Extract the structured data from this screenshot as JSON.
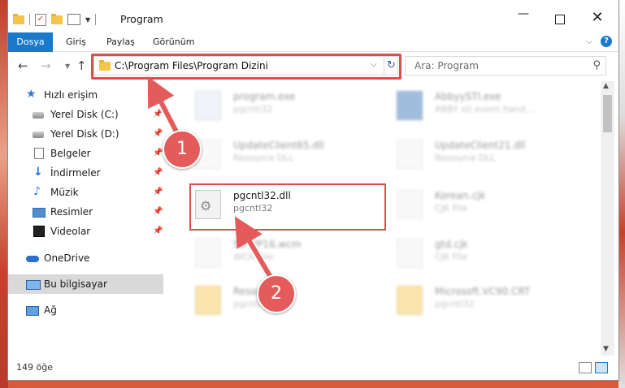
{
  "window": {
    "title": "Program"
  },
  "ribbon": {
    "tabs": [
      "Dosya",
      "Giriş",
      "Paylaş",
      "Görünüm"
    ],
    "help_label": "?"
  },
  "nav": {
    "address": "C:\\Program Files\\Program Dizini",
    "search_placeholder": "Ara: Program"
  },
  "sidebar": {
    "items": [
      {
        "label": "Hızlı erişim",
        "icon": "star-icon"
      },
      {
        "label": "Yerel Disk (C:)",
        "icon": "drive-icon"
      },
      {
        "label": "Yerel Disk (D:)",
        "icon": "drive-icon"
      },
      {
        "label": "Belgeler",
        "icon": "document-icon"
      },
      {
        "label": "İndirmeler",
        "icon": "download-icon"
      },
      {
        "label": "Müzik",
        "icon": "music-icon"
      },
      {
        "label": "Resimler",
        "icon": "pictures-icon"
      },
      {
        "label": "Videolar",
        "icon": "video-icon"
      },
      {
        "label": "OneDrive",
        "icon": "cloud-icon"
      },
      {
        "label": "Bu bilgisayar",
        "icon": "computer-icon"
      },
      {
        "label": "Ağ",
        "icon": "network-icon"
      }
    ]
  },
  "files": [
    {
      "name": "program.exe",
      "sub": "pgcntl32"
    },
    {
      "name": "AbbyySTI.exe",
      "sub": "ABBY sti event hand..."
    },
    {
      "name": "UpdateClient65.dll",
      "sub": "Resource DLL"
    },
    {
      "name": "UpdateClient21.dll",
      "sub": "Resource DLL"
    },
    {
      "name": "pgcntl32.dll",
      "sub": "pgcntl32"
    },
    {
      "name": "Korean.cjk",
      "sub": "CJK File"
    },
    {
      "name": "StrWP16.wcm",
      "sub": "WCM File"
    },
    {
      "name": "gtd.cjk",
      "sub": "CJK File"
    },
    {
      "name": "Resources",
      "sub": "pgcntl32"
    },
    {
      "name": "Microsoft.VC90.CRT",
      "sub": "pgcntl32"
    }
  ],
  "status": {
    "count": "149 öğe"
  },
  "annotations": {
    "step1": "1",
    "step2": "2"
  },
  "colors": {
    "accent": "#1979ca",
    "highlight": "#e04b4b"
  }
}
